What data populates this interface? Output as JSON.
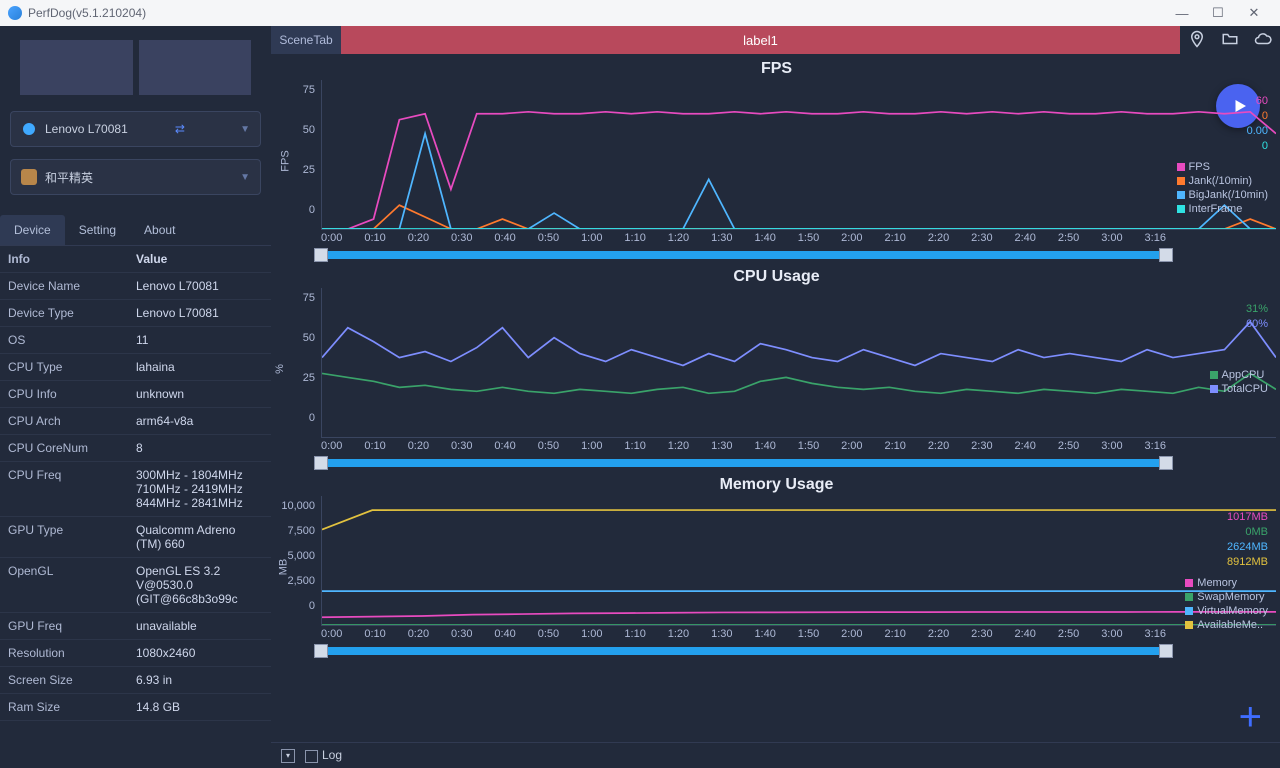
{
  "window": {
    "title": "PerfDog(v5.1.210204)"
  },
  "sidebar": {
    "device_dd": "Lenovo L70081",
    "app_dd": "和平精英",
    "tabs": [
      "Device",
      "Setting",
      "About"
    ],
    "active_tab": 0,
    "table_hdr": {
      "c1": "Info",
      "c2": "Value"
    },
    "rows": [
      {
        "k": "Device Name",
        "v": "Lenovo L70081"
      },
      {
        "k": "Device Type",
        "v": "Lenovo L70081"
      },
      {
        "k": "OS",
        "v": "11"
      },
      {
        "k": "CPU Type",
        "v": "lahaina"
      },
      {
        "k": "CPU Info",
        "v": "unknown"
      },
      {
        "k": "CPU Arch",
        "v": "arm64-v8a"
      },
      {
        "k": "CPU CoreNum",
        "v": "8"
      },
      {
        "k": "CPU Freq",
        "v": "300MHz - 1804MHz 710MHz - 2419MHz 844MHz - 2841MHz"
      },
      {
        "k": "GPU Type",
        "v": "Qualcomm Adreno (TM) 660"
      },
      {
        "k": "OpenGL",
        "v": "OpenGL ES 3.2 V@0530.0 (GIT@66c8b3o99c"
      },
      {
        "k": "GPU Freq",
        "v": "unavailable"
      },
      {
        "k": "Resolution",
        "v": "1080x2460"
      },
      {
        "k": "Screen Size",
        "v": "6.93 in"
      },
      {
        "k": "Ram Size",
        "v": "14.8 GB"
      }
    ]
  },
  "tabbar": {
    "scene": "SceneTab",
    "label": "label1"
  },
  "footer": {
    "log": "Log"
  },
  "chart_data": [
    {
      "type": "line",
      "title": "FPS",
      "ylabel": "FPS",
      "ylim": [
        0,
        75
      ],
      "yticks": [
        0,
        25,
        50,
        75
      ],
      "x_labels": [
        "0:00",
        "0:10",
        "0:20",
        "0:30",
        "0:40",
        "0:50",
        "1:00",
        "1:10",
        "1:20",
        "1:30",
        "1:40",
        "1:50",
        "2:00",
        "2:10",
        "2:20",
        "2:30",
        "2:40",
        "2:50",
        "3:00",
        "3:16"
      ],
      "series": [
        {
          "name": "FPS",
          "color": "#e84bc0",
          "value_label": "60",
          "values": [
            0,
            0,
            5,
            55,
            58,
            20,
            58,
            58,
            59,
            58,
            58,
            59,
            58,
            59,
            58,
            58,
            59,
            58,
            59,
            58,
            58,
            59,
            58,
            58,
            59,
            58,
            59,
            58,
            59,
            58,
            58,
            59,
            58,
            58,
            59,
            58,
            59,
            48
          ]
        },
        {
          "name": "Jank(/10min)",
          "color": "#ff7a2e",
          "value_label": "0",
          "values": [
            0,
            0,
            0,
            12,
            6,
            0,
            0,
            5,
            0,
            0,
            0,
            0,
            0,
            0,
            0,
            0,
            0,
            0,
            0,
            0,
            0,
            0,
            0,
            0,
            0,
            0,
            0,
            0,
            0,
            0,
            0,
            0,
            0,
            0,
            0,
            0,
            5,
            0
          ]
        },
        {
          "name": "BigJank(/10min)",
          "color": "#4fb6ff",
          "value_label": "0.00",
          "values": [
            0,
            0,
            0,
            0,
            48,
            0,
            0,
            0,
            0,
            8,
            0,
            0,
            0,
            0,
            0,
            25,
            0,
            0,
            0,
            0,
            0,
            0,
            0,
            0,
            0,
            0,
            0,
            0,
            0,
            0,
            0,
            0,
            0,
            0,
            0,
            12,
            0,
            0
          ]
        },
        {
          "name": "InterFrame",
          "color": "#2fe2e2",
          "value_label": "0",
          "values": [
            0,
            0,
            0,
            0,
            0,
            0,
            0,
            0,
            0,
            0,
            0,
            0,
            0,
            0,
            0,
            0,
            0,
            0,
            0,
            0,
            0,
            0,
            0,
            0,
            0,
            0,
            0,
            0,
            0,
            0,
            0,
            0,
            0,
            0,
            0,
            0,
            0,
            0
          ]
        }
      ]
    },
    {
      "type": "line",
      "title": "CPU Usage",
      "ylabel": "%",
      "ylim": [
        0,
        75
      ],
      "yticks": [
        0,
        25,
        50,
        75
      ],
      "x_labels": [
        "0:00",
        "0:10",
        "0:20",
        "0:30",
        "0:40",
        "0:50",
        "1:00",
        "1:10",
        "1:20",
        "1:30",
        "1:40",
        "1:50",
        "2:00",
        "2:10",
        "2:20",
        "2:30",
        "2:40",
        "2:50",
        "3:00",
        "3:16"
      ],
      "series": [
        {
          "name": "AppCPU",
          "color": "#3aa36a",
          "value_label": "31%",
          "values": [
            32,
            30,
            28,
            25,
            26,
            24,
            23,
            25,
            23,
            22,
            24,
            23,
            22,
            24,
            25,
            22,
            23,
            28,
            30,
            27,
            25,
            24,
            25,
            23,
            22,
            24,
            23,
            22,
            24,
            23,
            22,
            24,
            23,
            22,
            25,
            23,
            32,
            24
          ]
        },
        {
          "name": "TotalCPU",
          "color": "#7e8eff",
          "value_label": "60%",
          "values": [
            40,
            55,
            48,
            40,
            43,
            38,
            45,
            55,
            40,
            50,
            42,
            38,
            44,
            40,
            36,
            42,
            38,
            47,
            44,
            40,
            38,
            44,
            40,
            36,
            42,
            40,
            38,
            44,
            40,
            42,
            40,
            38,
            44,
            40,
            42,
            44,
            58,
            40
          ]
        }
      ]
    },
    {
      "type": "line",
      "title": "Memory Usage",
      "ylabel": "MB",
      "ylim": [
        0,
        10000
      ],
      "yticks": [
        0,
        2500,
        5000,
        7500,
        10000
      ],
      "x_labels": [
        "0:00",
        "0:10",
        "0:20",
        "0:30",
        "0:40",
        "0:50",
        "1:00",
        "1:10",
        "1:20",
        "1:30",
        "1:40",
        "1:50",
        "2:00",
        "2:10",
        "2:20",
        "2:30",
        "2:40",
        "2:50",
        "3:00",
        "3:16"
      ],
      "series": [
        {
          "name": "Memory",
          "color": "#e84bc0",
          "value_label": "1017MB",
          "values": [
            600,
            650,
            700,
            800,
            850,
            900,
            920,
            950,
            970,
            980,
            990,
            1000,
            1000,
            1005,
            1010,
            1010,
            1012,
            1014,
            1015,
            1017
          ]
        },
        {
          "name": "SwapMemory",
          "color": "#3aa36a",
          "value_label": "0MB",
          "values": [
            0,
            0,
            0,
            0,
            0,
            0,
            0,
            0,
            0,
            0,
            0,
            0,
            0,
            0,
            0,
            0,
            0,
            0,
            0,
            0
          ]
        },
        {
          "name": "VirtualMemory",
          "color": "#4fb6ff",
          "value_label": "2624MB",
          "values": [
            2624,
            2624,
            2624,
            2624,
            2624,
            2624,
            2624,
            2624,
            2624,
            2624,
            2624,
            2624,
            2624,
            2624,
            2624,
            2624,
            2624,
            2624,
            2624,
            2624
          ]
        },
        {
          "name": "AvailableMe..",
          "color": "#e2c23f",
          "value_label": "8912MB",
          "values": [
            7400,
            8900,
            8910,
            8912,
            8912,
            8912,
            8912,
            8912,
            8912,
            8912,
            8912,
            8912,
            8912,
            8912,
            8912,
            8912,
            8912,
            8912,
            8912,
            8912
          ]
        }
      ]
    }
  ]
}
